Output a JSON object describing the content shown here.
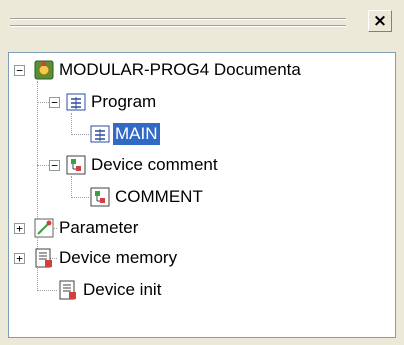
{
  "toolbar": {
    "close_label": "×"
  },
  "tree": {
    "root": {
      "label": "MODULAR-PROG4 Documenta",
      "icon": "project-icon",
      "expander": "−"
    },
    "program": {
      "label": "Program",
      "icon": "program-icon",
      "expander": "−"
    },
    "main": {
      "label": "MAIN",
      "icon": "program-icon",
      "selected": true
    },
    "device_comment": {
      "label": "Device comment",
      "icon": "comment-icon",
      "expander": "−"
    },
    "comment": {
      "label": "COMMENT",
      "icon": "comment-icon"
    },
    "parameter": {
      "label": "Parameter",
      "icon": "parameter-icon",
      "expander": "+"
    },
    "device_memory": {
      "label": "Device memory",
      "icon": "memory-icon",
      "expander": "+"
    },
    "device_init": {
      "label": "Device init",
      "icon": "init-icon"
    }
  },
  "colors": {
    "selection": "#316ac5",
    "panel": "#ece9d8",
    "tree_bg": "#ffffff"
  }
}
